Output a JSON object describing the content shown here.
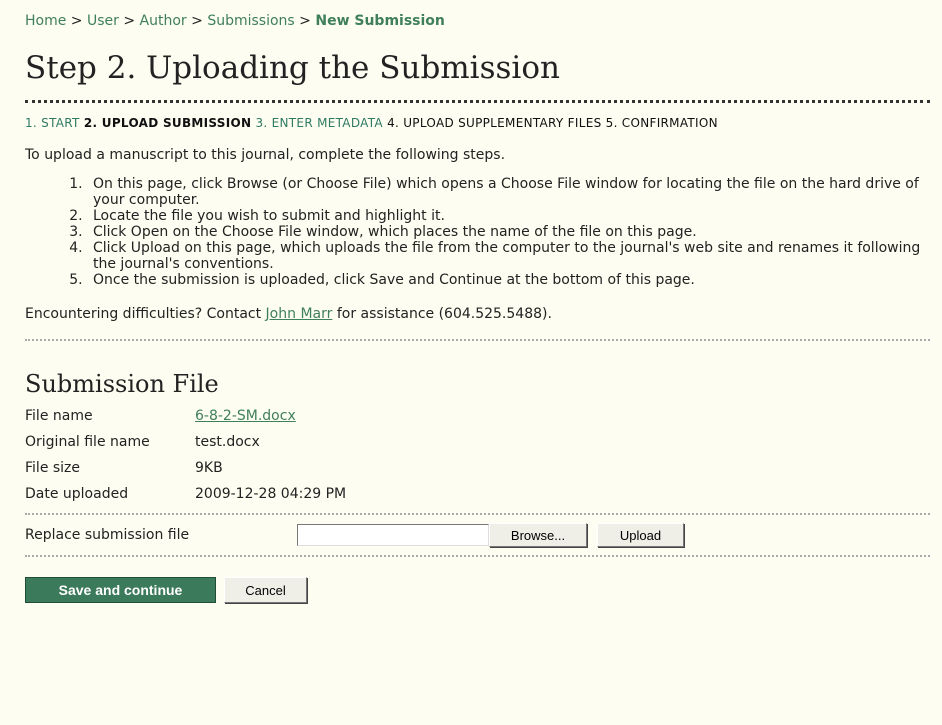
{
  "breadcrumb": {
    "items": [
      "Home",
      "User",
      "Author",
      "Submissions"
    ],
    "separator": ">",
    "current": "New Submission"
  },
  "page_title": "Step 2. Uploading the Submission",
  "steps": [
    {
      "label": "1. Start",
      "state": "link"
    },
    {
      "label": "2. Upload Submission",
      "state": "current"
    },
    {
      "label": "3. Enter Metadata",
      "state": "link"
    },
    {
      "label": "4. Upload Supplementary Files",
      "state": "plain"
    },
    {
      "label": "5. Confirmation",
      "state": "plain"
    }
  ],
  "intro": "To upload a manuscript to this journal, complete the following steps.",
  "instructions": [
    "On this page, click Browse (or Choose File) which opens a Choose File window for locating the file on the hard drive of your computer.",
    "Locate the file you wish to submit and highlight it.",
    "Click Open on the Choose File window, which places the name of the file on this page.",
    "Click Upload on this page, which uploads the file from the computer to the journal's web site and renames it following the journal's conventions.",
    "Once the submission is uploaded, click Save and Continue at the bottom of this page."
  ],
  "contact": {
    "prefix": "Encountering difficulties? Contact ",
    "name": "John Marr",
    "suffix": " for assistance (604.525.5488)."
  },
  "submission_file": {
    "title": "Submission File",
    "file_name_label": "File name",
    "file_name": "6-8-2-SM.docx",
    "original_name_label": "Original file name",
    "original_name": "test.docx",
    "file_size_label": "File size",
    "file_size": "9KB",
    "date_uploaded_label": "Date uploaded",
    "date_uploaded": "2009-12-28 04:29 PM"
  },
  "replace": {
    "label": "Replace submission file",
    "file_value": "",
    "browse_label": "Browse...",
    "upload_label": "Upload"
  },
  "actions": {
    "save_label": "Save and continue",
    "cancel_label": "Cancel"
  },
  "colors": {
    "background": "#fdfdf1",
    "link": "#3f7f5a",
    "primary_button": "#3c7a5c"
  }
}
